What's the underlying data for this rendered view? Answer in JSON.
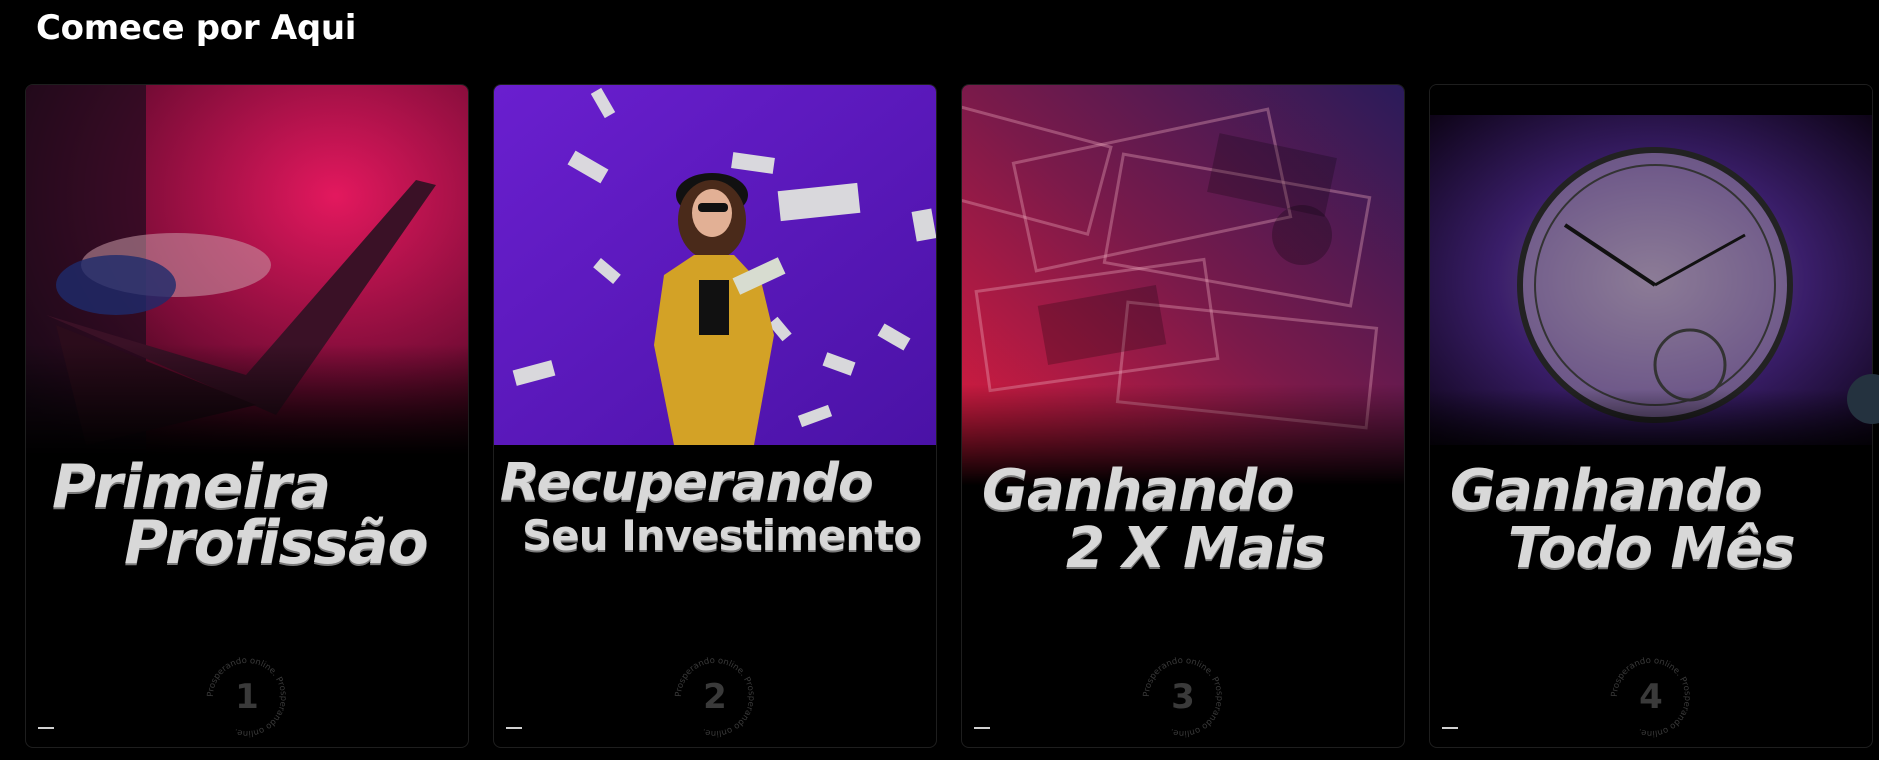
{
  "section": {
    "title": "Comece por Aqui"
  },
  "cards": [
    {
      "line1": "Primeira",
      "line2": "Profissão",
      "number": "1",
      "badge_text": "Prosperando online. Prosperando online."
    },
    {
      "line1": "Recuperando",
      "line2": "Seu Investimento",
      "number": "2",
      "badge_text": "Prosperando online. Prosperando online."
    },
    {
      "line1": "Ganhando",
      "line2": "2 X Mais",
      "number": "3",
      "badge_text": "Prosperando online. Prosperando online."
    },
    {
      "line1": "Ganhando",
      "line2": "Todo Mês",
      "number": "4",
      "badge_text": "Prosperando online. Prosperando online."
    }
  ],
  "icons": {
    "next": "chevron-right-icon",
    "progress": "progress-dash-icon"
  }
}
